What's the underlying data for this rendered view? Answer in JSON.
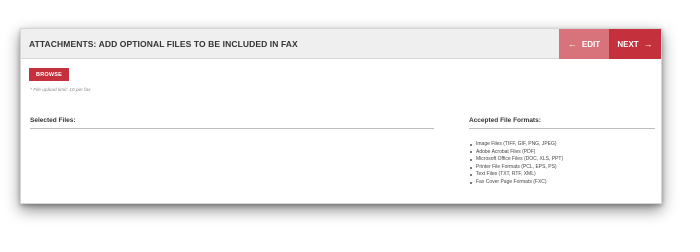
{
  "header": {
    "title": "ATTACHMENTS: ADD OPTIONAL FILES TO BE INCLUDED IN FAX",
    "edit_label": "EDIT",
    "next_label": "NEXT"
  },
  "upload": {
    "browse_label": "BROWSE",
    "limit_note": "* File upload limit: 10 per fax"
  },
  "selected_files": {
    "label": "Selected Files:"
  },
  "accepted_formats": {
    "label": "Accepted File Formats:",
    "items": [
      "Image Files (TIFF, GIF, PNG, JPEG)",
      "Adobe Acrobat Files (PDF)",
      "Microsoft Office Files (DOC, XLS, PPT)",
      "Printer File Formats (PCL, EPS, PS)",
      "Text Files (TXT, RTF, XML)",
      "Fax Cover Page Formats (FXC)"
    ]
  },
  "icons": {
    "edit": "arrow-left-icon",
    "next": "arrow-right-icon"
  },
  "colors": {
    "primary": "#c4313c",
    "primary_light": "#d9737b",
    "header_bg": "#efefef"
  }
}
